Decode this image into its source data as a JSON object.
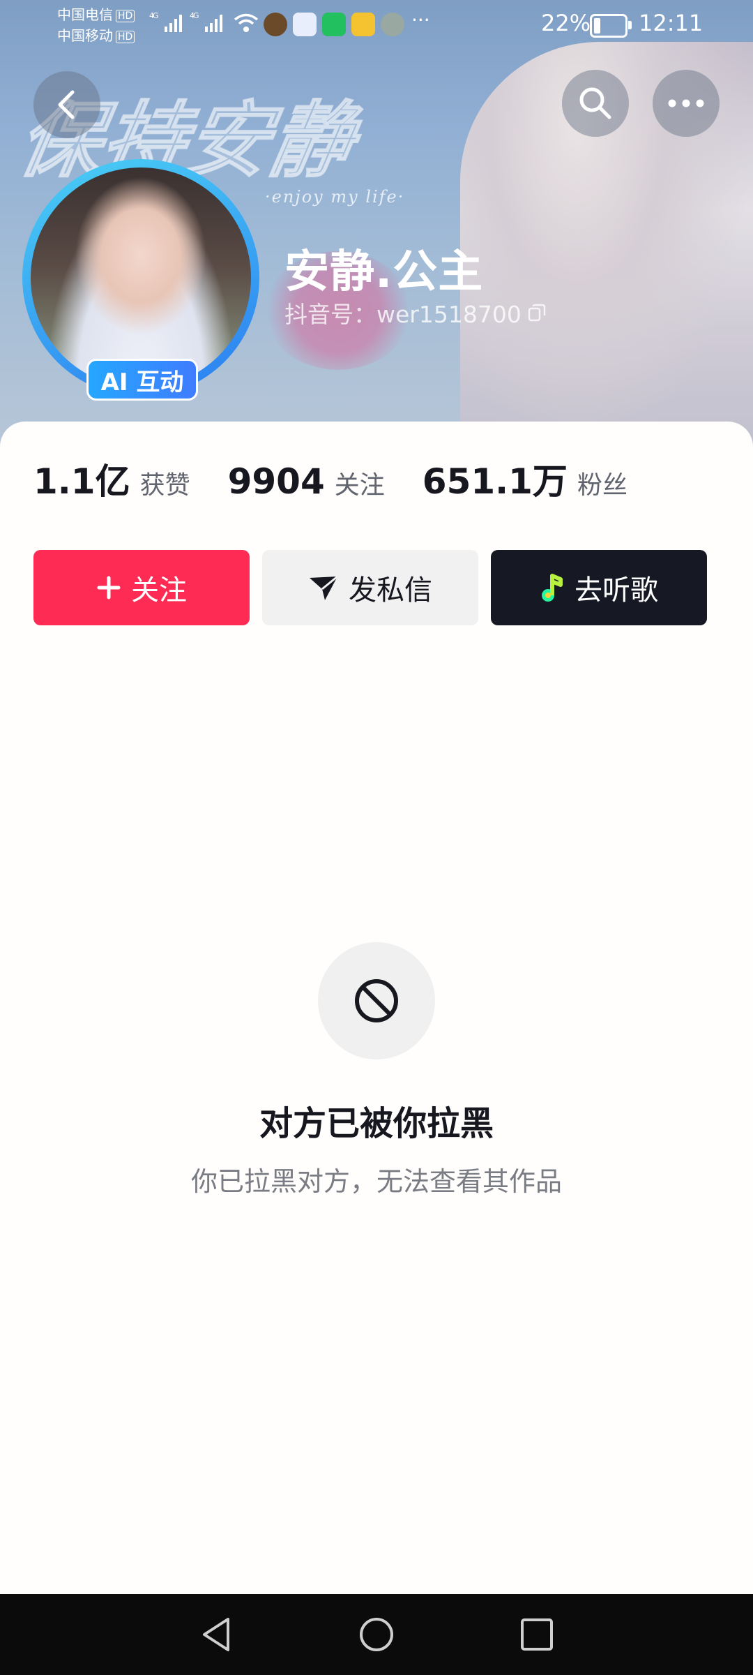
{
  "status_bar": {
    "carrier1": "中国电信",
    "carrier2": "中国移动",
    "hd_badge": "HD",
    "network1": "4G",
    "network2": "4G",
    "more_indicator": "···",
    "battery_percent_text": "22%",
    "battery_level": 0.22,
    "time": "12:11"
  },
  "banner": {
    "deco_text": "保持安静",
    "deco_subtext": "·enjoy my life·"
  },
  "profile": {
    "ai_badge": "AI 互动",
    "name": "安静.公主",
    "id_label": "抖音号：wer1518700"
  },
  "stats": [
    {
      "value": "1.1亿",
      "label": "获赞"
    },
    {
      "value": "9904",
      "label": "关注"
    },
    {
      "value": "651.1万",
      "label": "粉丝"
    }
  ],
  "actions": {
    "follow_label": "关注",
    "message_label": "发私信",
    "music_label": "去听歌"
  },
  "blocked": {
    "title": "对方已被你拉黑",
    "description": "你已拉黑对方，无法查看其作品"
  },
  "colors": {
    "follow": "#fe2c55",
    "music": "#161823",
    "message": "#f1f1f2"
  },
  "icons": [
    "back-icon",
    "search-icon",
    "more-icon",
    "copy-icon",
    "plus-icon",
    "send-icon",
    "music-note-icon",
    "blocked-icon",
    "nav-back-icon",
    "nav-home-icon",
    "nav-recents-icon"
  ]
}
